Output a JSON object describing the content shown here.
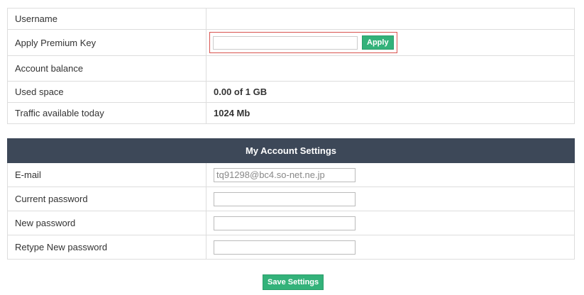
{
  "account_info": {
    "username_label": "Username",
    "username_value": "",
    "premium_label": "Apply Premium Key",
    "premium_input_value": "",
    "apply_label": "Apply",
    "balance_label": "Account balance",
    "balance_value": "",
    "used_space_label": "Used space",
    "used_space_value": "0.00 of 1 GB",
    "traffic_label": "Traffic available today",
    "traffic_value": "1024 Mb"
  },
  "settings": {
    "header": "My Account Settings",
    "email_label": "E-mail",
    "email_placeholder": "tq91298@bc4.so-net.ne.jp",
    "current_password_label": "Current password",
    "new_password_label": "New password",
    "retype_password_label": "Retype New password",
    "save_label": "Save Settings"
  },
  "colors": {
    "header_bg": "#3d4858",
    "button_green": "#33b27a",
    "highlight_border": "#d9534f"
  }
}
